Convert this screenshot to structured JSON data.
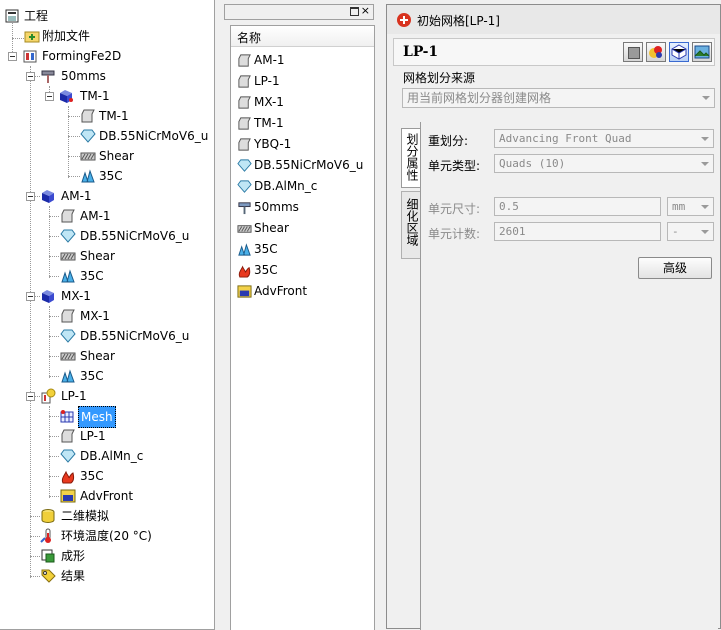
{
  "tree": {
    "root": "工程",
    "attach_files": "附加文件",
    "forming": "FormingFe2D",
    "mms50": "50mms",
    "tm1": "TM-1",
    "tm1_child": "TM-1",
    "db55_1": "DB.55NiCrMoV6_u",
    "shear_1": "Shear",
    "c35_1": "35C",
    "am1": "AM-1",
    "am1_child": "AM-1",
    "db55_2": "DB.55NiCrMoV6_u",
    "shear_2": "Shear",
    "c35_2": "35C",
    "mx1": "MX-1",
    "mx1_child": "MX-1",
    "db55_3": "DB.55NiCrMoV6_u",
    "shear_3": "Shear",
    "c35_3": "35C",
    "lp1": "LP-1",
    "mesh": "Mesh",
    "lp1_child": "LP-1",
    "dbalmn": "DB.AlMn_c",
    "c35_4": "35C",
    "advfront": "AdvFront",
    "sim2d": "二维模拟",
    "env_temp": "环境温度(20 °C)",
    "forming_cn": "成形",
    "result": "结果"
  },
  "list": {
    "header": "名称",
    "items": [
      "AM-1",
      "LP-1",
      "MX-1",
      "TM-1",
      "YBQ-1",
      "DB.55NiCrMoV6_u",
      "DB.AlMn_c",
      "50mms",
      "Shear",
      "35C",
      "35C",
      "AdvFront"
    ]
  },
  "dialog": {
    "title": "初始网格[LP-1]",
    "name": "LP-1",
    "source_group_label": "网格划分来源",
    "source_value": "用当前网格划分器创建网格",
    "tab_props": "划分属性",
    "tab_refine": "细化区域",
    "remesh_label": "重划分:",
    "remesh_value": "Advancing Front Quad",
    "elem_type_label": "单元类型:",
    "elem_type_value": "Quads (10)",
    "elem_size_label": "单元尺寸:",
    "elem_size_value": "0.5",
    "elem_size_unit": "mm",
    "elem_count_label": "单元计数:",
    "elem_count_value": "2601",
    "elem_count_unit": "-",
    "advanced_btn": "高级"
  },
  "colors": {
    "selection": "#3399ff",
    "panel_border": "#a0a0a0",
    "dialog_bg": "#f0f0f0",
    "titlebar_bg": "#e8e8e8"
  }
}
